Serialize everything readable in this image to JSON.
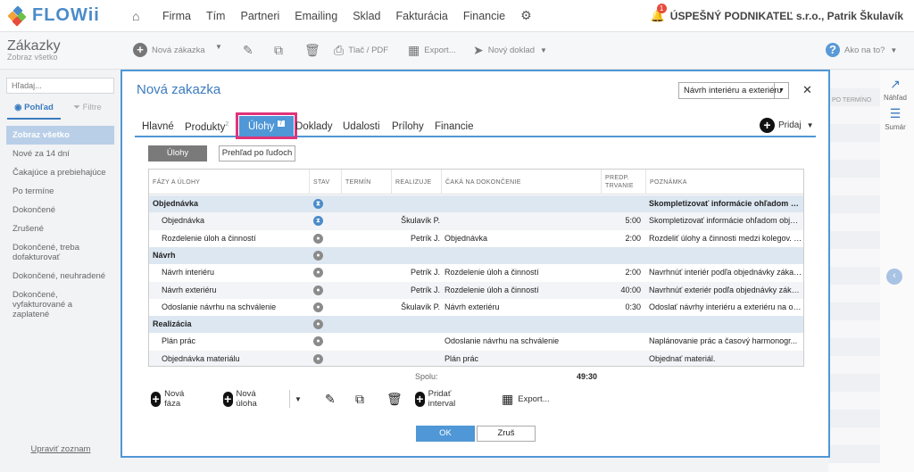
{
  "nav": {
    "logo": "FLOWii",
    "items": [
      "Firma",
      "Tím",
      "Partneri",
      "Emailing",
      "Sklad",
      "Fakturácia",
      "Financie"
    ],
    "notifications_count": "1",
    "account": "ÚSPEŠNÝ PODNIKATEĽ s.r.o., Patrik Škulavík"
  },
  "toolbar": {
    "title": "Zákazky",
    "subtitle": "Zobraz všetko",
    "new_order": "Nová zákazka",
    "print": "Tlač / PDF",
    "export": "Export...",
    "new_doc": "Nový doklad",
    "help": "Ako na to?"
  },
  "sidebar": {
    "search_placeholder": "Hľadaj...",
    "tab_view": "Pohľad",
    "tab_filter": "Filtre",
    "items": [
      "Zobraz všetko",
      "Nové za 14 dní",
      "Čakajúce a prebiehajúce",
      "Po termíne",
      "Dokončené",
      "Zrušené",
      "Dokončené, treba dofakturovať",
      "Dokončené, neuhradené",
      "Dokončené, vyfakturované a zaplatené"
    ],
    "footer": "Upraviť zoznam"
  },
  "right_panel": {
    "col_head": "PO TERMÍNO",
    "preview": "Náhľad",
    "summary": "Sumár"
  },
  "modal": {
    "title": "Nová zakazka",
    "template_select": "Návrh interiéru a exteriéru",
    "tabs": [
      {
        "label": "Hlavné",
        "badge": ""
      },
      {
        "label": "Produkty",
        "badge": "2"
      },
      {
        "label": "Úlohy",
        "badge": "7"
      },
      {
        "label": "Doklady",
        "badge": ""
      },
      {
        "label": "Udalosti",
        "badge": ""
      },
      {
        "label": "Prílohy",
        "badge": ""
      },
      {
        "label": "Financie",
        "badge": ""
      }
    ],
    "add_label": "Pridaj",
    "sub_tabs": [
      "Úlohy",
      "Prehľad po ľuďoch"
    ],
    "columns": [
      "FÁZY A ÚLOHY",
      "STAV",
      "TERMÍN",
      "REALIZUJE",
      "ČAKÁ NA DOKONČENIE",
      "PREDP. TRVANIE",
      "POZNÁMKA"
    ],
    "rows": [
      {
        "type": "group",
        "name": "Objednávka",
        "status": "blue",
        "assignee": "",
        "waits": "",
        "duration": "",
        "note": "Skompletizovať informácie ohľadom objed..."
      },
      {
        "type": "task",
        "name": "Objednávka",
        "status": "blue",
        "assignee": "Škulavík P.",
        "waits": "",
        "duration": "5:00",
        "note": "Skompletizovať informácie ohľadom objed..."
      },
      {
        "type": "task",
        "name": "Rozdelenie úloh a činností",
        "status": "gray",
        "assignee": "Petrík J.",
        "waits": "Objednávka",
        "duration": "2:00",
        "note": "Rozdeliť úlohy a činnosti medzi kolegov. St..."
      },
      {
        "type": "group",
        "name": "Návrh",
        "status": "gray",
        "assignee": "",
        "waits": "",
        "duration": "",
        "note": ""
      },
      {
        "type": "task",
        "name": "Návrh interiéru",
        "status": "gray",
        "assignee": "Petrík J.",
        "waits": "Rozdelenie úloh a činností",
        "duration": "2:00",
        "note": "Navrhnúť interiér podľa objednávky zákazn..."
      },
      {
        "type": "task",
        "name": "Návrh exteriéru",
        "status": "gray",
        "assignee": "Petrík J.",
        "waits": "Rozdelenie úloh a činností",
        "duration": "40:00",
        "note": "Navrhnúť exteriér podľa objednávky zákaz..."
      },
      {
        "type": "task",
        "name": "Odoslanie návrhu na schválenie",
        "status": "gray",
        "assignee": "Škulavík P.",
        "waits": "Návrh exteriéru",
        "duration": "0:30",
        "note": "Odoslať návrhy interiéru a exteriéru na ods..."
      },
      {
        "type": "group",
        "name": "Realizácia",
        "status": "gray",
        "assignee": "",
        "waits": "",
        "duration": "",
        "note": ""
      },
      {
        "type": "task",
        "name": "Plán prác",
        "status": "gray",
        "assignee": "",
        "waits": "Odoslanie návrhu na schválenie",
        "duration": "",
        "note": "Naplánovanie prác a časový harmonogr..."
      },
      {
        "type": "task",
        "name": "Objednávka materiálu",
        "status": "gray",
        "assignee": "",
        "waits": "Plán prác",
        "duration": "",
        "note": "Objednať materiál."
      }
    ],
    "sum_label": "Spolu:",
    "sum_value": "49:30",
    "actions": {
      "new_phase": "Nová fáza",
      "new_task": "Nová úloha",
      "add_interval": "Pridať interval",
      "export": "Export..."
    },
    "ok": "OK",
    "cancel": "Zruš"
  }
}
